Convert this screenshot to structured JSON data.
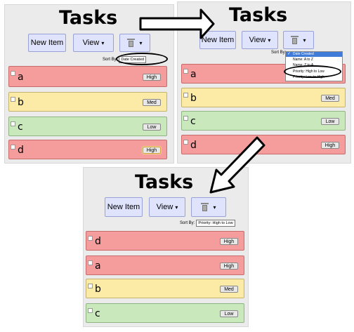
{
  "title": "Tasks",
  "toolbar": {
    "new_item": "New Item",
    "view": "View",
    "caret": "▾"
  },
  "sort_label": "Sort By:",
  "panels": {
    "p1": {
      "sort_value": "Date Created",
      "tasks": [
        {
          "name": "a",
          "priority": "High"
        },
        {
          "name": "b",
          "priority": "Med"
        },
        {
          "name": "c",
          "priority": "Low"
        },
        {
          "name": "d",
          "priority": "High"
        }
      ]
    },
    "p2": {
      "sort_value": "Date Created",
      "tasks": [
        {
          "name": "a",
          "priority": "High"
        },
        {
          "name": "b",
          "priority": "Med"
        },
        {
          "name": "c",
          "priority": "Low"
        },
        {
          "name": "d",
          "priority": "High"
        }
      ],
      "dropdown": [
        "Date Created",
        "Name: A to Z",
        "Name: Z to A",
        "Priority: High to Low",
        "Priority: Low to High"
      ]
    },
    "p3": {
      "sort_value": "Priority: High to Low",
      "tasks": [
        {
          "name": "d",
          "priority": "High"
        },
        {
          "name": "a",
          "priority": "High"
        },
        {
          "name": "b",
          "priority": "Med"
        },
        {
          "name": "c",
          "priority": "Low"
        }
      ]
    }
  },
  "colors": {
    "high": "#f59d9d",
    "med": "#fbeba6",
    "low": "#c9e8bc",
    "button": "#dfe3fb",
    "selected": "#3f7bd9"
  },
  "icons": {
    "trash": "trash-icon",
    "check": "checkmark-icon",
    "arrow": "arrow-icon"
  }
}
